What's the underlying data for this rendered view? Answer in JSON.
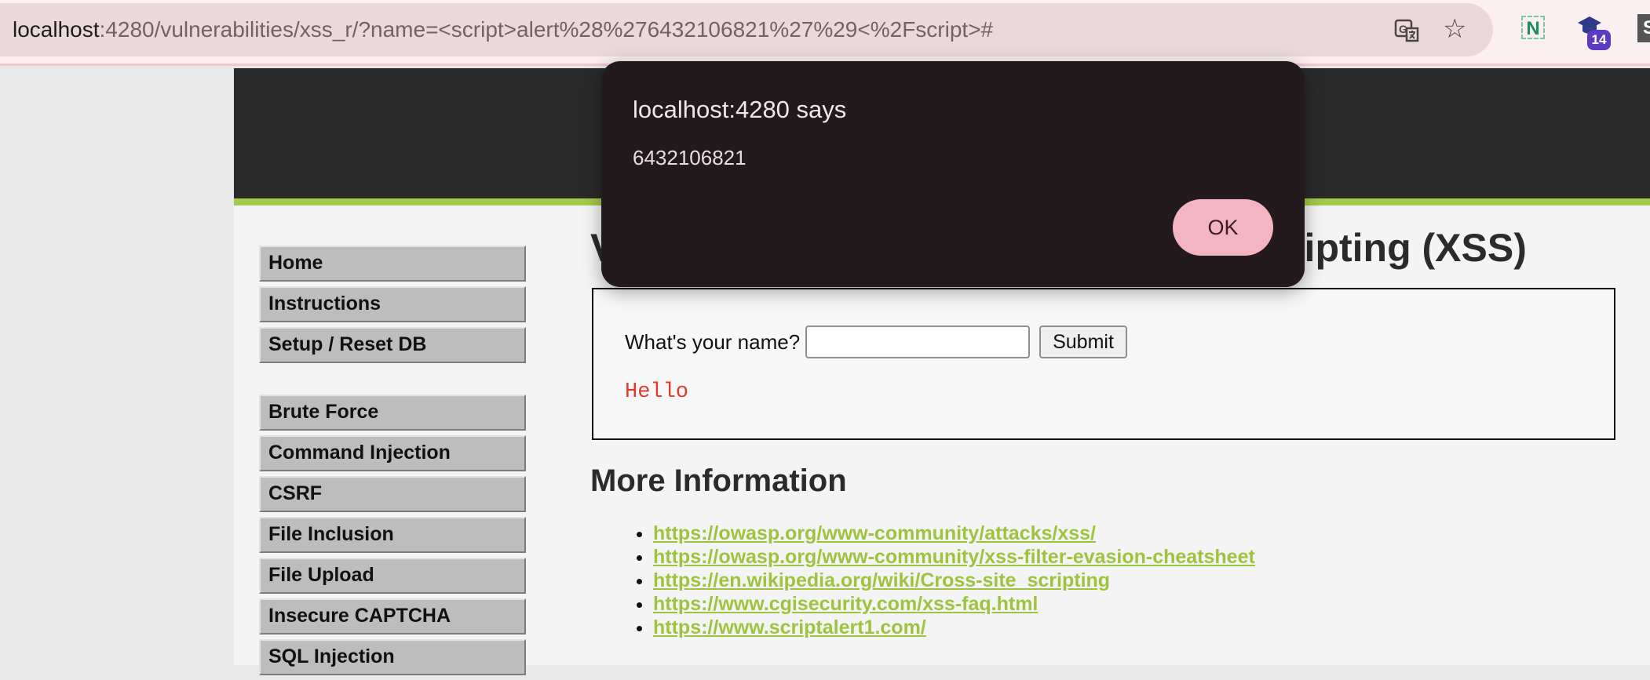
{
  "browser": {
    "url_host": "localhost",
    "url_rest": ":4280/vulnerabilities/xss_r/?name=<script>alert%28%276432106821%27%29<%2Fscript>#",
    "extension_n_label": "N",
    "extension_badge": "14",
    "extension_s_label": "S",
    "icons": [
      "translate-icon",
      "star-icon",
      "extension-n-icon",
      "graduation-cap-icon",
      "extension-s-icon"
    ]
  },
  "sidebar": {
    "group1": [
      "Home",
      "Instructions",
      "Setup / Reset DB"
    ],
    "group2": [
      "Brute Force",
      "Command Injection",
      "CSRF",
      "File Inclusion",
      "File Upload",
      "Insecure CAPTCHA",
      "SQL Injection"
    ]
  },
  "main": {
    "title": "Vulnerability: Reflected Cross Site Scripting (XSS)",
    "form": {
      "label": "What's your name?",
      "input_value": "",
      "submit_label": "Submit"
    },
    "output": "Hello",
    "more_info_heading": "More Information",
    "links": [
      "https://owasp.org/www-community/attacks/xss/",
      "https://owasp.org/www-community/xss-filter-evasion-cheatsheet",
      "https://en.wikipedia.org/wiki/Cross-site_scripting",
      "https://www.cgisecurity.com/xss-faq.html",
      "https://www.scriptalert1.com/"
    ]
  },
  "alert": {
    "title": "localhost:4280 says",
    "message": "6432106821",
    "ok_label": "OK"
  },
  "colors": {
    "header_bg": "#2a2a2a",
    "accent_green": "#a5c94b",
    "link_green": "#9ec33f",
    "output_red": "#e03a2f",
    "dialog_bg": "#221a1d",
    "ok_button": "#f3b5c1"
  }
}
